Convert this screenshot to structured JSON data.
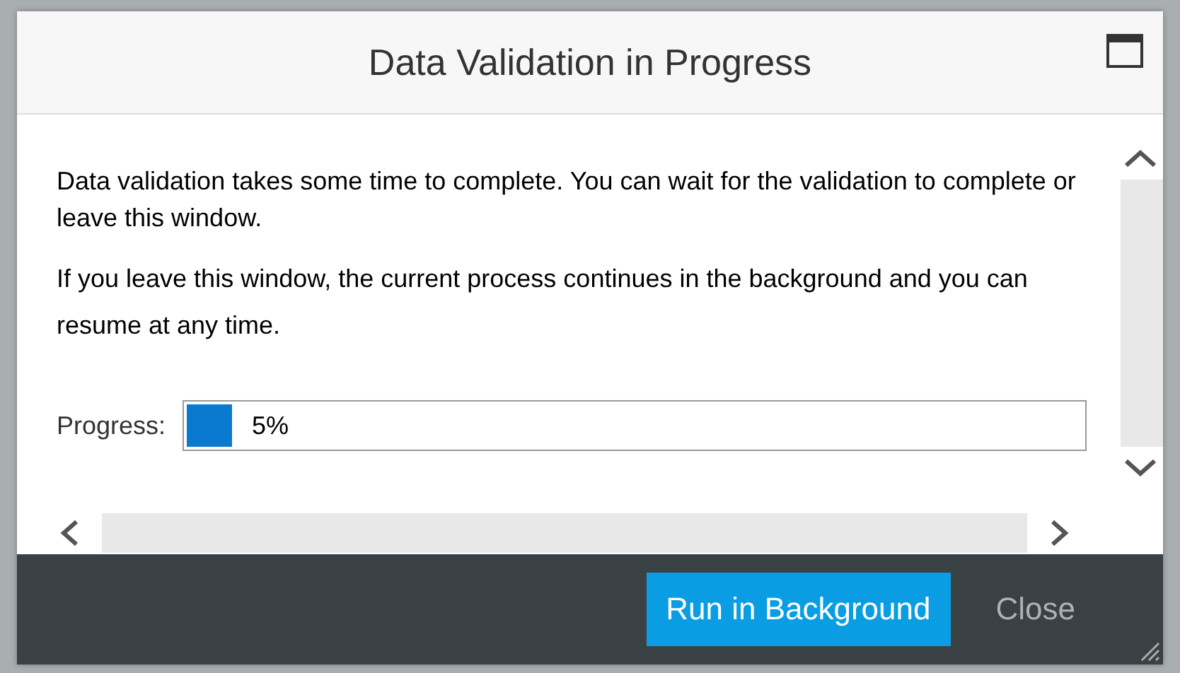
{
  "dialog": {
    "title": "Data Validation in Progress",
    "paragraphs": [
      "Data validation takes some time to complete. You can wait for the validation to complete or leave this window.",
      "If you leave this window, the current process continues in the background and you can resume at any time."
    ],
    "progress": {
      "label": "Progress:",
      "level": 0.05,
      "reading": "5%"
    },
    "buttons": [
      {
        "label": "Run in Background",
        "kind": "primary"
      },
      {
        "label": "Close",
        "kind": "plain"
      }
    ]
  }
}
